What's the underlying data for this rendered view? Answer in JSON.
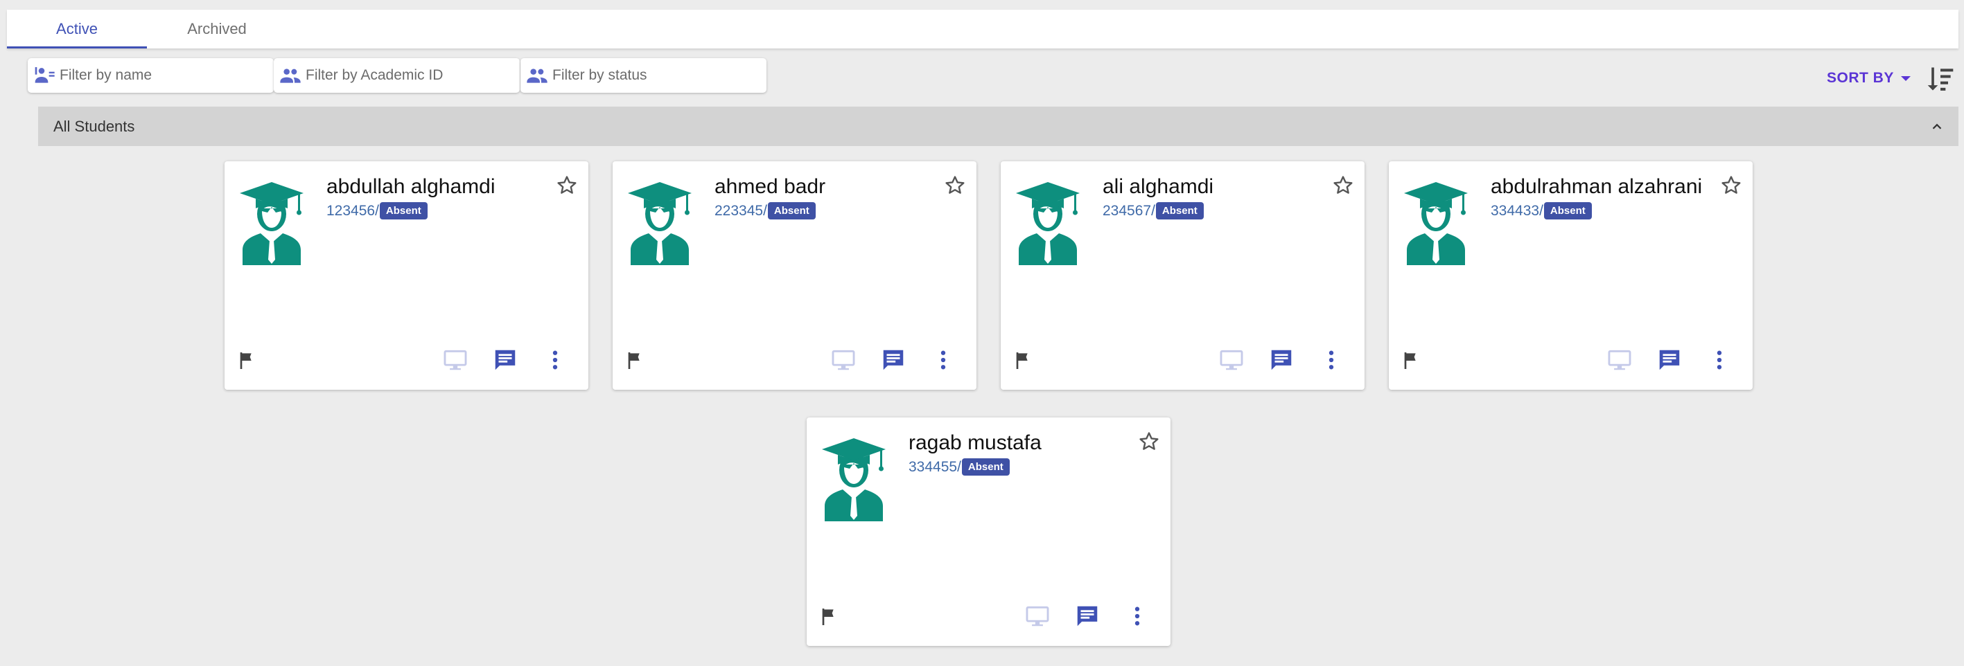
{
  "tabs": [
    {
      "label": "Active",
      "active": true
    },
    {
      "label": "Archived",
      "active": false
    }
  ],
  "filters": {
    "name_placeholder": "Filter by name",
    "academic_id_placeholder": "Filter by Academic ID",
    "status_placeholder": "Filter by status"
  },
  "sort": {
    "label": "SORT BY"
  },
  "section": {
    "title": "All Students"
  },
  "students": [
    {
      "name": "abdullah alghamdi",
      "id": "123456",
      "separator": "/",
      "status": "Absent"
    },
    {
      "name": "ahmed badr",
      "id": "223345",
      "separator": "/",
      "status": "Absent"
    },
    {
      "name": "ali alghamdi",
      "id": "234567",
      "separator": "/",
      "status": "Absent"
    },
    {
      "name": "abdulrahman alzahrani",
      "id": "334433",
      "separator": "/",
      "status": "Absent"
    },
    {
      "name": "ragab mustafa",
      "id": "334455",
      "separator": "/",
      "status": "Absent"
    }
  ],
  "colors": {
    "accent": "#3f51b5",
    "sort_purple": "#5b35d5",
    "avatar_teal": "#0e8f7e",
    "badge": "#3f51a5"
  },
  "icons": {
    "avatar": "graduate-avatar-icon",
    "star": "star-outline-icon",
    "flag": "flag-icon",
    "monitor": "monitor-icon",
    "chat": "chat-icon",
    "more": "more-vert-icon"
  }
}
